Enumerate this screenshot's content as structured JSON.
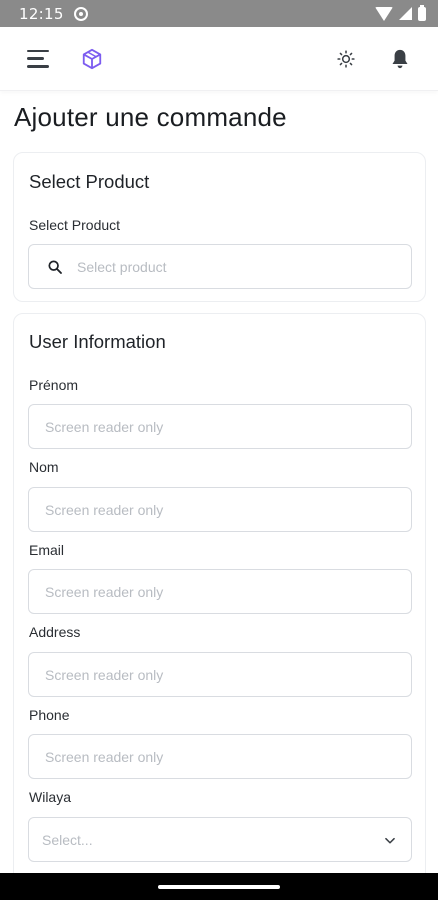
{
  "status_bar": {
    "time": "12:15"
  },
  "header": {
    "menu_icon": "hamburger-icon",
    "logo_icon": "cube-logo-icon",
    "theme_icon": "sun-icon",
    "notification_icon": "bell-icon",
    "accent_color": "#7c5cf0"
  },
  "page": {
    "title": "Ajouter une commande"
  },
  "product_section": {
    "title": "Select Product",
    "field_label": "Select Product",
    "search_placeholder": "Select product"
  },
  "user_section": {
    "title": "User Information",
    "fields": [
      {
        "label": "Prénom",
        "placeholder": "Screen reader only"
      },
      {
        "label": "Nom",
        "placeholder": "Screen reader only"
      },
      {
        "label": "Email",
        "placeholder": "Screen reader only"
      },
      {
        "label": "Address",
        "placeholder": "Screen reader only"
      },
      {
        "label": "Phone",
        "placeholder": "Screen reader only"
      }
    ],
    "wilaya": {
      "label": "Wilaya",
      "placeholder": "Select..."
    }
  }
}
